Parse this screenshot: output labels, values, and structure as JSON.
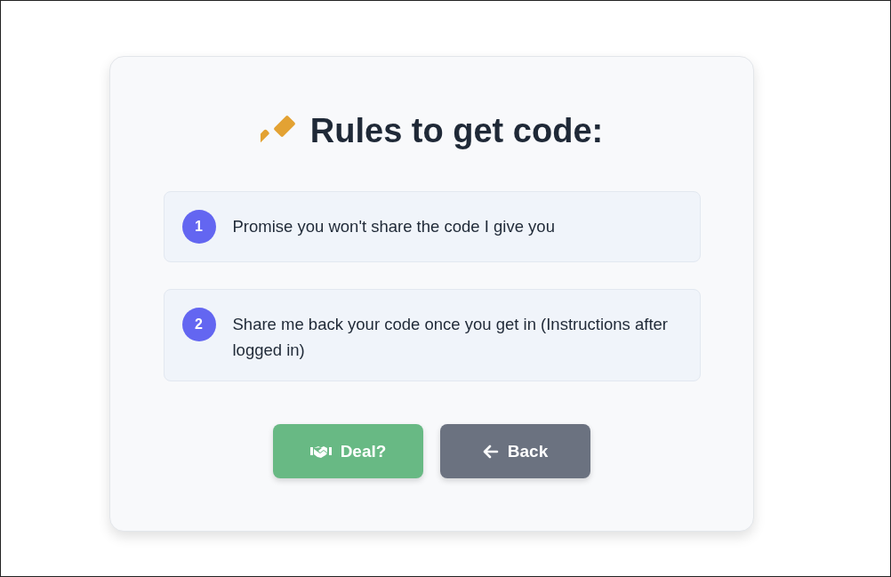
{
  "title": "Rules to get code:",
  "rules": [
    {
      "number": "1",
      "text": "Promise you won't share the code I give you"
    },
    {
      "number": "2",
      "text": "Share me back your code once you get in (Instructions after logged in)"
    }
  ],
  "buttons": [
    {
      "kind": "deal",
      "label": "Deal?"
    },
    {
      "kind": "back",
      "label": "Back"
    }
  ]
}
